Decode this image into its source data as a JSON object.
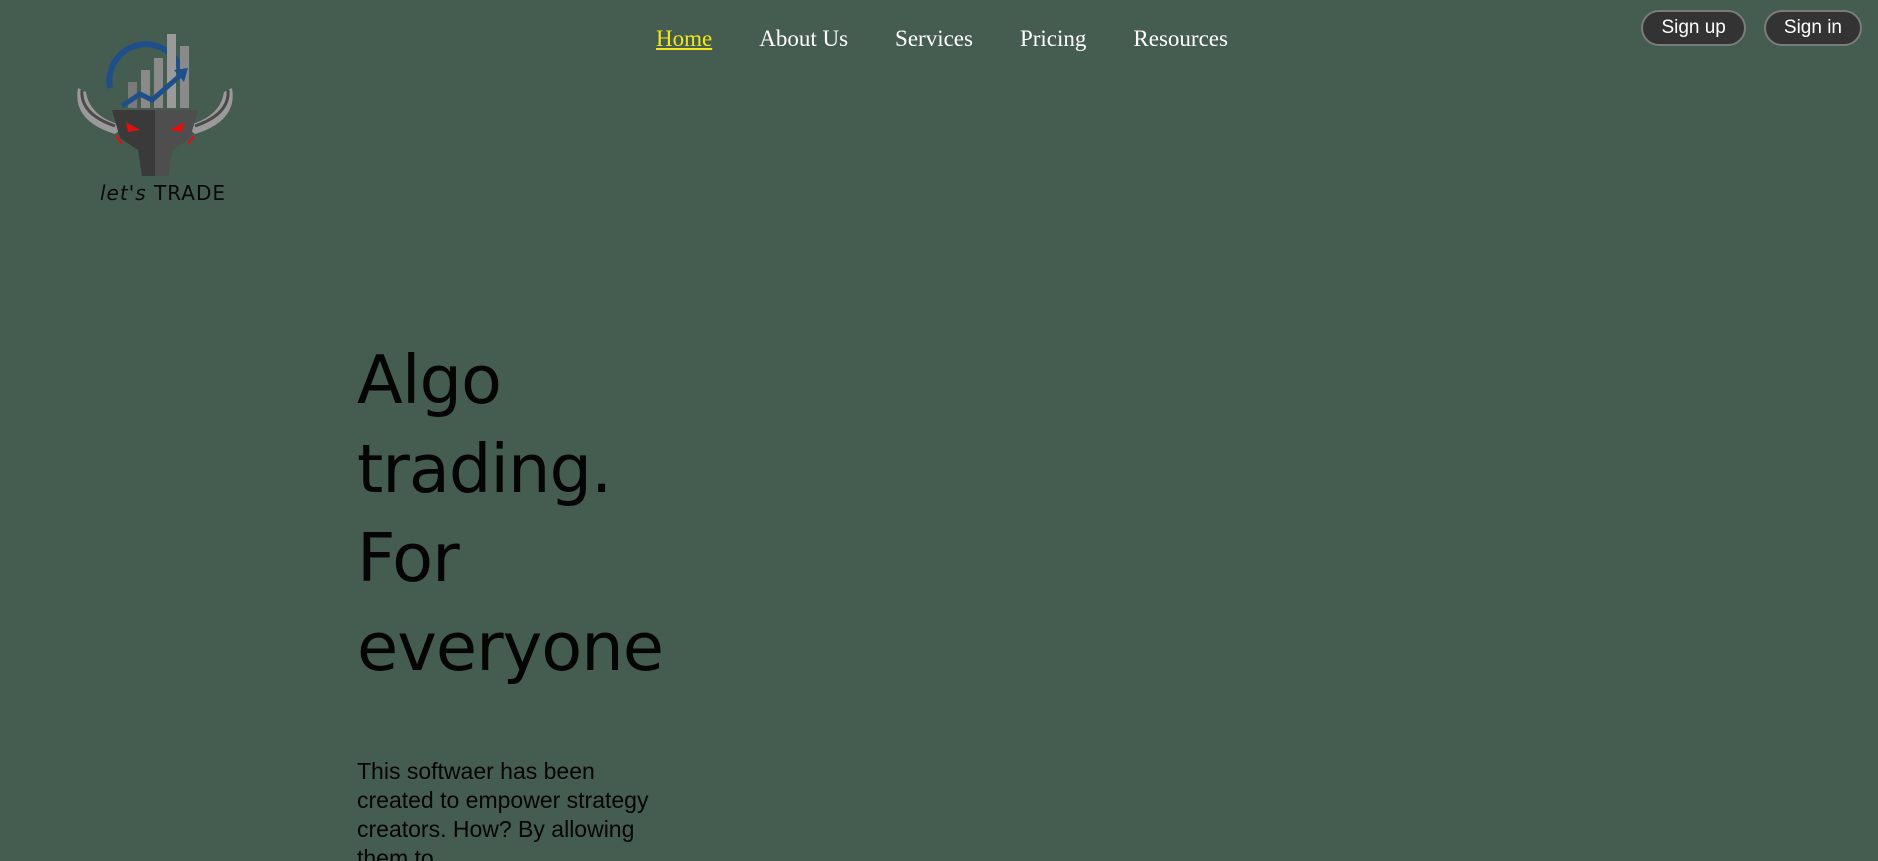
{
  "logo": {
    "brand_prefix": "let's",
    "brand_name": "TRADE",
    "icon": "bull-chart-logo"
  },
  "nav": {
    "items": [
      {
        "label": "Home",
        "active": true
      },
      {
        "label": "About Us",
        "active": false
      },
      {
        "label": "Services",
        "active": false
      },
      {
        "label": "Pricing",
        "active": false
      },
      {
        "label": "Resources",
        "active": false
      }
    ]
  },
  "auth": {
    "signup_label": "Sign up",
    "signin_label": "Sign in"
  },
  "hero": {
    "title_lines": [
      "Algo",
      "trading.",
      "For",
      "everyone"
    ],
    "description": "This softwaer has been created to empower strategy creators. How? By allowing them to"
  },
  "colors": {
    "background": "#455c50",
    "nav_text": "#ffffff",
    "nav_active": "#f2e51b",
    "button_bg": "#333333",
    "button_border": "#7b7b7b",
    "hero_text": "#050505"
  }
}
